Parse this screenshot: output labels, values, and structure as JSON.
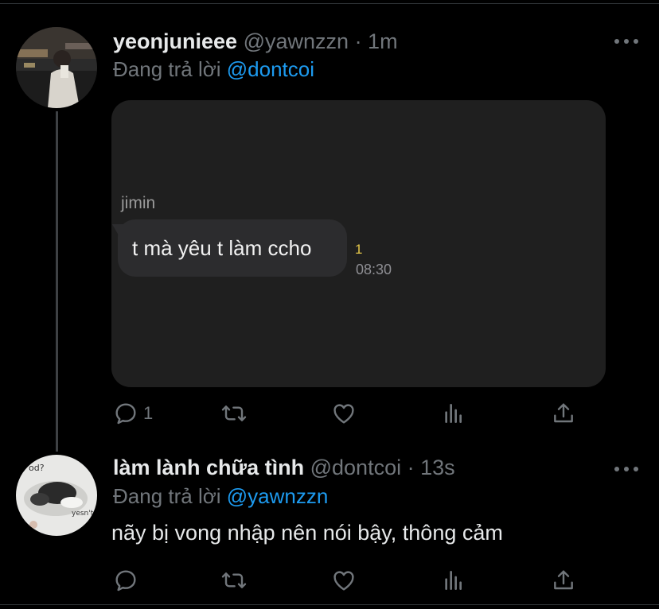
{
  "tweets": [
    {
      "display_name": "yeonjunieee",
      "handle": "@yawnzzn",
      "time": "· 1m",
      "replying_prefix": "Đang trả lời ",
      "replying_to": "@dontcoi",
      "media": {
        "sender": "jimin",
        "message": "t mà yêu t làm ccho",
        "unread": "1",
        "time": "08:30"
      },
      "reply_count": "1"
    },
    {
      "display_name": "làm lành chữa tình",
      "handle": "@dontcoi",
      "time": "· 13s",
      "replying_prefix": "Đang trả lời ",
      "replying_to": "@yawnzzn",
      "text": "nãy bị vong nhập nên nói bậy, thông cảm",
      "reply_count": ""
    }
  ],
  "avatar2_text": {
    "top": "od?",
    "bottom": "yesn't"
  },
  "colors": {
    "accent": "#1d9bf0",
    "muted": "#71767b",
    "background": "#000000"
  },
  "icons": [
    "reply-icon",
    "retweet-icon",
    "like-icon",
    "analytics-icon",
    "share-icon",
    "more-icon"
  ]
}
